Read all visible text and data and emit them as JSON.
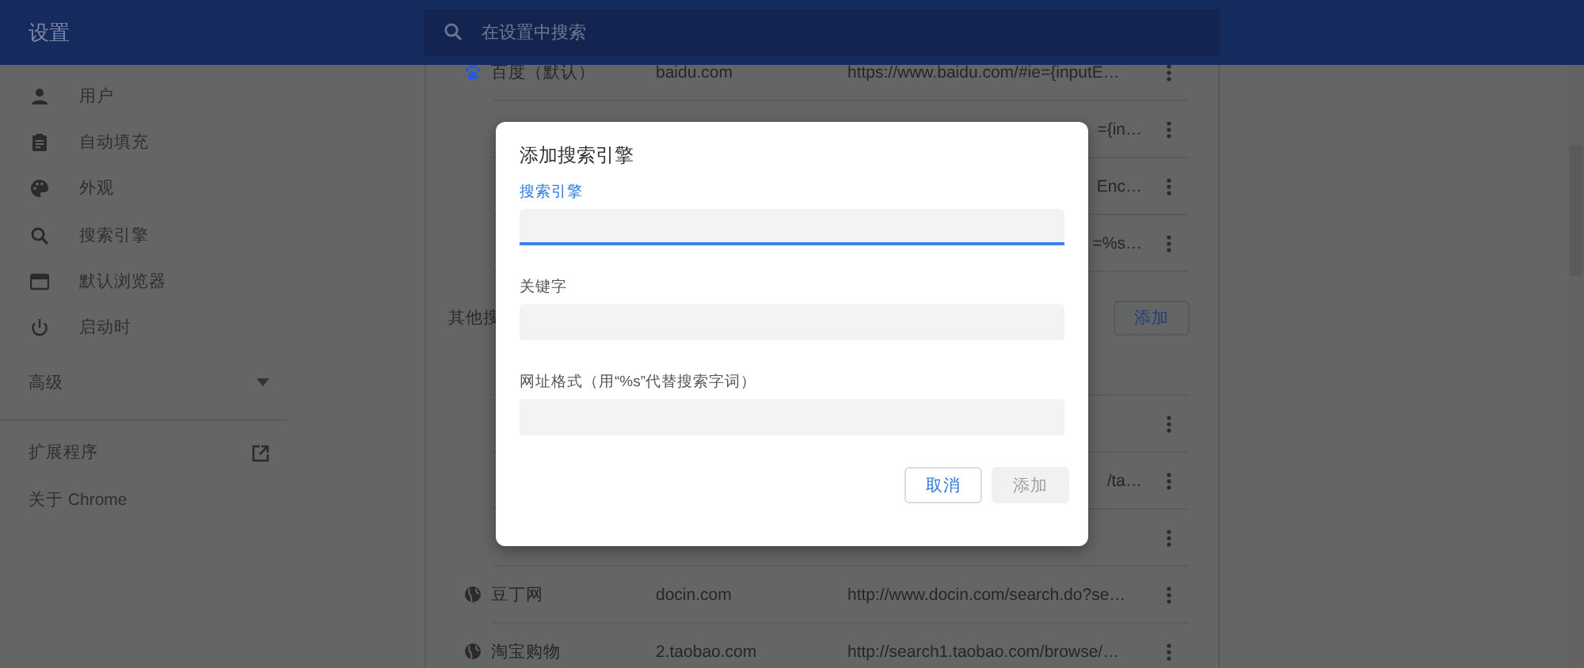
{
  "header": {
    "title": "设置",
    "search": {
      "placeholder": "在设置中搜索"
    }
  },
  "sidebar": {
    "items": [
      {
        "label": "用户"
      },
      {
        "label": "自动填充"
      },
      {
        "label": "外观"
      },
      {
        "label": "搜索引擎"
      },
      {
        "label": "默认浏览器"
      },
      {
        "label": "启动时"
      }
    ],
    "advanced": {
      "label": "高级",
      "expanded": false
    },
    "links": [
      {
        "label": "扩展程序",
        "external": true
      },
      {
        "label": "关于 Chrome",
        "external": false
      }
    ]
  },
  "default_engines": [
    {
      "name": "百度（默认）",
      "keyword": "baidu.com",
      "url": "https://www.baidu.com/#ie={inputE…",
      "has_menu": true
    },
    {
      "url": "={in…",
      "has_menu": true
    },
    {
      "url": "Enc…",
      "has_menu": true
    },
    {
      "url": "=%s…",
      "has_menu": true
    }
  ],
  "other_section": {
    "title": "其他搜",
    "add_button": "添加"
  },
  "other_engines": [
    {
      "has_menu": true
    },
    {
      "url": "/ta…",
      "has_menu": true
    },
    {
      "has_menu": true
    },
    {
      "name": "豆丁网",
      "keyword": "docin.com",
      "url": "http://www.docin.com/search.do?se…",
      "has_menu": true
    },
    {
      "name": "淘宝购物",
      "keyword": "2.taobao.com",
      "url": "http://search1.taobao.com/browse/…",
      "has_menu": true
    }
  ],
  "dialog": {
    "title": "添加搜索引擎",
    "fields": [
      {
        "label": "搜索引擎",
        "focused": true
      },
      {
        "label": "关键字",
        "focused": false
      },
      {
        "label": "网址格式（用“%s”代替搜索字词）",
        "focused": false
      }
    ],
    "buttons": [
      {
        "label": "取消",
        "disabled": false
      },
      {
        "label": "添加",
        "disabled": true
      }
    ]
  }
}
